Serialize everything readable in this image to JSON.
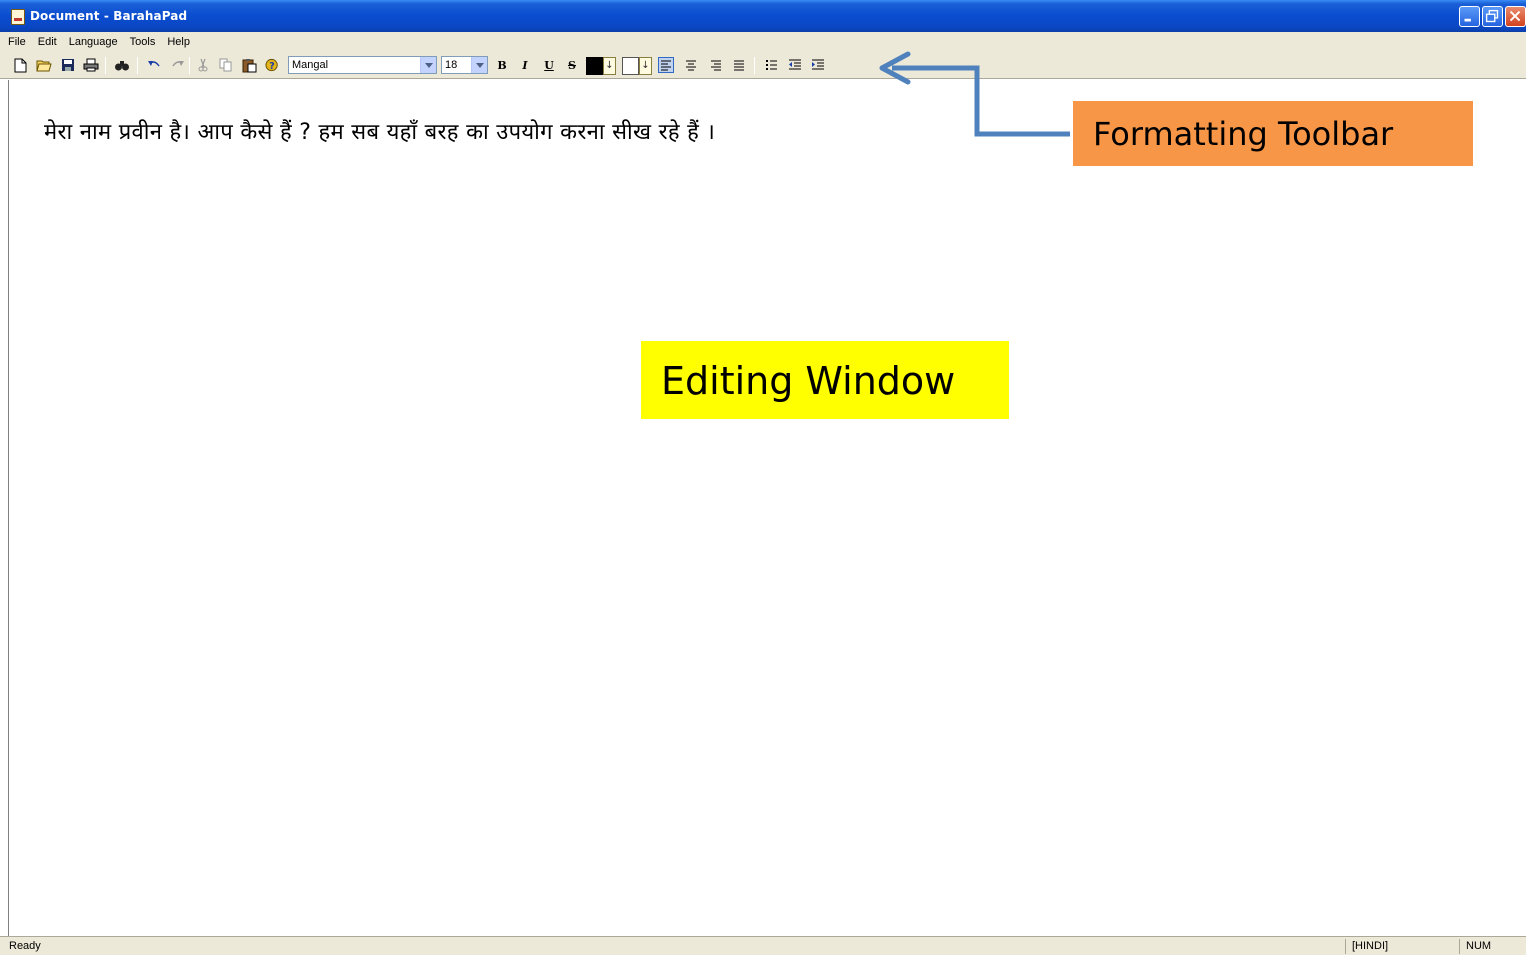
{
  "window": {
    "title": "Document - BarahaPad"
  },
  "menu": [
    "File",
    "Edit",
    "Language",
    "Tools",
    "Help"
  ],
  "toolbar": {
    "font_name": "Mangal",
    "font_size": "18",
    "bold_label": "B",
    "italic_label": "I",
    "underline_label": "U",
    "strike_label": "S",
    "text_color": "#000000",
    "highlight_color": "#ffffff",
    "icons": [
      "new-icon",
      "open-icon",
      "save-icon",
      "print-icon",
      "find-icon",
      "undo-icon",
      "redo-icon",
      "cut-icon",
      "copy-icon",
      "paste-icon",
      "help-icon",
      "align-left-icon",
      "align-center-icon",
      "align-right-icon",
      "justify-icon",
      "bullets-icon",
      "decrease-indent-icon",
      "increase-indent-icon"
    ]
  },
  "editor": {
    "text": "मेरा नाम प्रवीन है।  आप कैसे हैं ? हम सब यहाँ बरह का उपयोग करना सीख रहे हैं ।"
  },
  "annotations": {
    "toolbar_label": "Formatting Toolbar",
    "toolbar_label_color": "#f79646",
    "editor_label": "Editing Window",
    "editor_label_color": "#ffff00",
    "arrow_color": "#4f81bd"
  },
  "status": {
    "ready": "Ready",
    "language": "[HINDI]",
    "num": "NUM"
  }
}
